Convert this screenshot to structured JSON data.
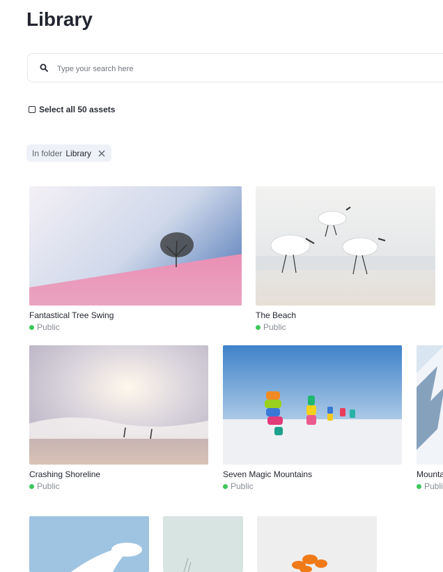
{
  "page": {
    "title": "Library"
  },
  "search": {
    "placeholder": "Type your search here"
  },
  "select_all": {
    "label": "Select all 50 assets"
  },
  "filter_chip": {
    "prefix": "In folder",
    "value": "Library"
  },
  "colors": {
    "status_public": "#3cc85a",
    "chip_bg": "#eef1f7"
  },
  "assets": [
    {
      "name": "Fantastical Tree Swing",
      "visibility": "Public"
    },
    {
      "name": "The Beach",
      "visibility": "Public"
    },
    {
      "name": "Crashing Shoreline",
      "visibility": "Public"
    },
    {
      "name": "Seven Magic Mountains",
      "visibility": "Public"
    },
    {
      "name": "Mountai",
      "visibility": "Publi"
    },
    {
      "name": "",
      "visibility": ""
    },
    {
      "name": "",
      "visibility": ""
    },
    {
      "name": "",
      "visibility": ""
    },
    {
      "name": "",
      "visibility": ""
    }
  ]
}
